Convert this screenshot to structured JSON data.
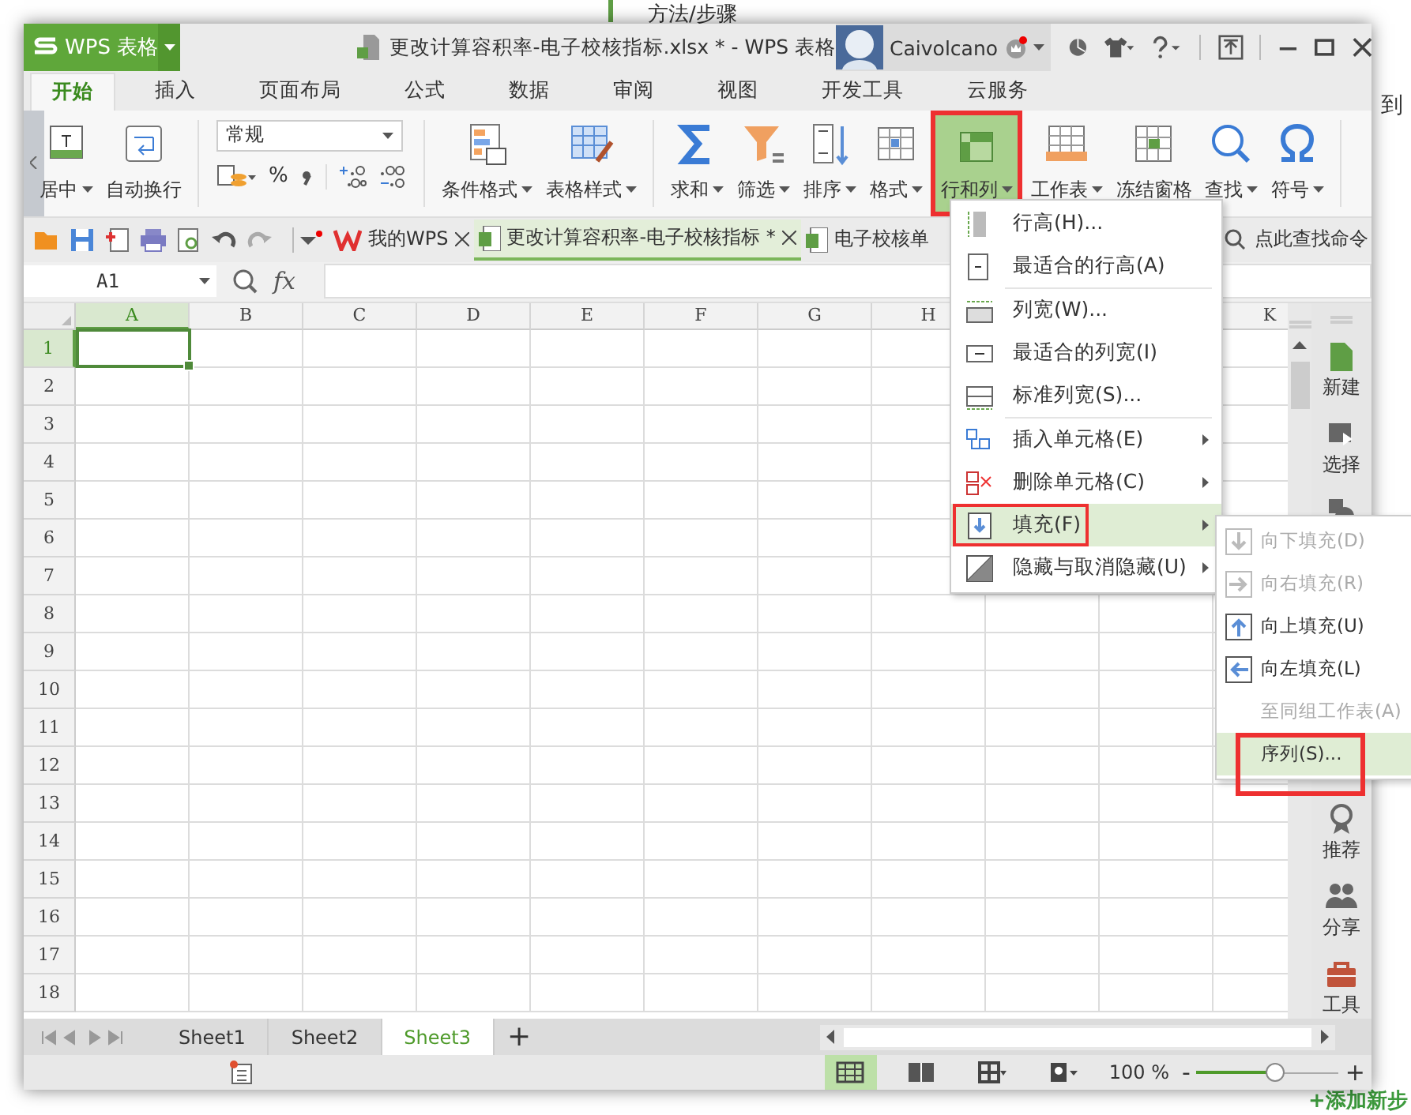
{
  "background_page": {
    "heading": "方法/步骤",
    "side_text": "到",
    "add_step": "+添加新步"
  },
  "window": {
    "app_name": "WPS 表格",
    "title": "更改计算容积率-电子校核指标.xlsx * - WPS 表格",
    "user": "Caivolcano"
  },
  "tabs": [
    {
      "label": "开始",
      "selected": true
    },
    {
      "label": "插入",
      "selected": false
    },
    {
      "label": "页面布局",
      "selected": false
    },
    {
      "label": "公式",
      "selected": false
    },
    {
      "label": "数据",
      "selected": false
    },
    {
      "label": "审阅",
      "selected": false
    },
    {
      "label": "视图",
      "selected": false
    },
    {
      "label": "开发工具",
      "selected": false
    },
    {
      "label": "云服务",
      "selected": false
    }
  ],
  "ribbon": [
    {
      "kind": "large",
      "label": "居中",
      "dropdown": true,
      "highlighted": false
    },
    {
      "kind": "large",
      "label": "自动换行",
      "dropdown": false,
      "highlighted": false
    },
    {
      "kind": "number",
      "value": "常规",
      "percent": "%"
    },
    {
      "kind": "large",
      "label": "条件格式",
      "dropdown": true,
      "highlighted": false
    },
    {
      "kind": "large",
      "label": "表格样式",
      "dropdown": true,
      "highlighted": false
    },
    {
      "kind": "large",
      "label": "求和",
      "dropdown": true,
      "highlighted": false
    },
    {
      "kind": "large",
      "label": "筛选",
      "dropdown": true,
      "highlighted": false
    },
    {
      "kind": "large",
      "label": "排序",
      "dropdown": true,
      "highlighted": false
    },
    {
      "kind": "large",
      "label": "格式",
      "dropdown": true,
      "highlighted": false
    },
    {
      "kind": "large",
      "label": "行和列",
      "dropdown": true,
      "highlighted": true
    },
    {
      "kind": "large",
      "label": "工作表",
      "dropdown": true,
      "highlighted": false
    },
    {
      "kind": "large",
      "label": "冻结窗格",
      "dropdown": false,
      "highlighted": false
    },
    {
      "kind": "large",
      "label": "查找",
      "dropdown": true,
      "highlighted": false
    },
    {
      "kind": "large",
      "label": "符号",
      "dropdown": true,
      "highlighted": false
    }
  ],
  "doc_tabs": [
    {
      "label": "我的WPS",
      "selected": false,
      "closable": true
    },
    {
      "label": "更改计算容积率-电子校核指标 *",
      "selected": true,
      "closable": true
    },
    {
      "label": "电子校核单",
      "selected": false,
      "closable": false
    }
  ],
  "command_search": {
    "placeholder": "点此查找命令"
  },
  "formula_bar": {
    "name_box": "A1",
    "function_label": "fx"
  },
  "columns": [
    {
      "label": "A",
      "selected": true
    },
    {
      "label": "B",
      "selected": false
    },
    {
      "label": "C",
      "selected": false
    },
    {
      "label": "D",
      "selected": false
    },
    {
      "label": "E",
      "selected": false
    },
    {
      "label": "F",
      "selected": false
    },
    {
      "label": "G",
      "selected": false
    },
    {
      "label": "H",
      "selected": false
    },
    {
      "label": "K",
      "selected": false
    }
  ],
  "rows": [
    {
      "label": "1",
      "selected": true
    },
    {
      "label": "2",
      "selected": false
    },
    {
      "label": "3",
      "selected": false
    },
    {
      "label": "4",
      "selected": false
    },
    {
      "label": "5",
      "selected": false
    },
    {
      "label": "6",
      "selected": false
    },
    {
      "label": "7",
      "selected": false
    },
    {
      "label": "8",
      "selected": false
    },
    {
      "label": "9",
      "selected": false
    },
    {
      "label": "10",
      "selected": false
    },
    {
      "label": "11",
      "selected": false
    },
    {
      "label": "12",
      "selected": false
    },
    {
      "label": "13",
      "selected": false
    },
    {
      "label": "14",
      "selected": false
    },
    {
      "label": "15",
      "selected": false
    },
    {
      "label": "16",
      "selected": false
    },
    {
      "label": "17",
      "selected": false
    },
    {
      "label": "18",
      "selected": false
    }
  ],
  "menu": [
    {
      "kind": "item",
      "label": "行高(H)...",
      "submenu": false,
      "selected": false,
      "highlighted": false
    },
    {
      "kind": "item",
      "label": "最适合的行高(A)",
      "submenu": false,
      "selected": false,
      "highlighted": false
    },
    {
      "kind": "separator"
    },
    {
      "kind": "item",
      "label": "列宽(W)...",
      "submenu": false,
      "selected": false,
      "highlighted": false
    },
    {
      "kind": "item",
      "label": "最适合的列宽(I)",
      "submenu": false,
      "selected": false,
      "highlighted": false
    },
    {
      "kind": "item",
      "label": "标准列宽(S)...",
      "submenu": false,
      "selected": false,
      "highlighted": false
    },
    {
      "kind": "separator"
    },
    {
      "kind": "item",
      "label": "插入单元格(E)",
      "submenu": true,
      "selected": false,
      "highlighted": false
    },
    {
      "kind": "item",
      "label": "删除单元格(C)",
      "submenu": true,
      "selected": false,
      "highlighted": false
    },
    {
      "kind": "item",
      "label": "填充(F)",
      "submenu": true,
      "selected": true,
      "highlighted": true
    },
    {
      "kind": "item",
      "label": "隐藏与取消隐藏(U)",
      "submenu": true,
      "selected": false,
      "highlighted": false
    }
  ],
  "submenu": [
    {
      "label": "向下填充(D)",
      "disabled": true,
      "selected": false,
      "highlighted": false
    },
    {
      "label": "向右填充(R)",
      "disabled": true,
      "selected": false,
      "highlighted": false
    },
    {
      "label": "向上填充(U)",
      "disabled": false,
      "selected": false,
      "highlighted": false
    },
    {
      "label": "向左填充(L)",
      "disabled": false,
      "selected": false,
      "highlighted": false
    },
    {
      "label": "至同组工作表(A)",
      "disabled": true,
      "selected": false,
      "highlighted": false
    },
    {
      "label": "序列(S)...",
      "disabled": false,
      "selected": true,
      "highlighted": true
    }
  ],
  "sidebar": [
    {
      "kind": "button",
      "label": "新建"
    },
    {
      "kind": "button",
      "label": "选择"
    },
    {
      "kind": "covered"
    },
    {
      "kind": "button",
      "label": "推荐"
    },
    {
      "kind": "button",
      "label": "分享"
    },
    {
      "kind": "button",
      "label": "工具"
    }
  ],
  "sheets": [
    {
      "label": "Sheet1",
      "selected": false
    },
    {
      "label": "Sheet2",
      "selected": false
    },
    {
      "label": "Sheet3",
      "selected": true
    }
  ],
  "add_sheet": "+",
  "status_bar": {
    "views": [
      {
        "selected": true
      },
      {
        "selected": false
      },
      {
        "selected": false
      },
      {
        "selected": false
      }
    ],
    "zoom": "100 %",
    "zoom_out": "-",
    "zoom_in": "+",
    "level": 0.55
  }
}
